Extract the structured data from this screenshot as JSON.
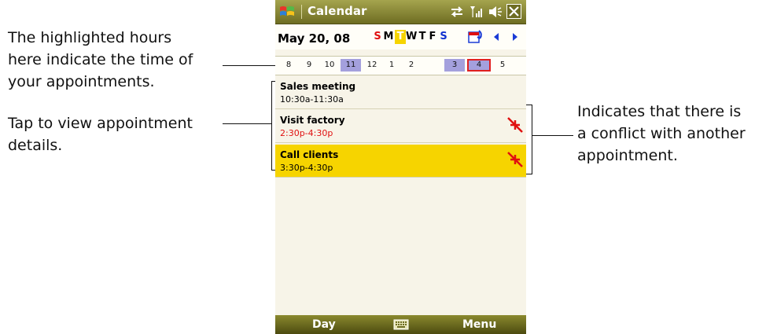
{
  "callouts": {
    "hours_note": [
      "The highlighted hours",
      "here indicate the time of",
      "your appointments."
    ],
    "tap_note": [
      "Tap to view appointment",
      "details."
    ],
    "conflict_note": [
      "Indicates that there is",
      "a conflict with another",
      "appointment."
    ]
  },
  "titlebar": {
    "title": "Calendar",
    "icons": [
      "windows-start-icon",
      "connectivity-icon",
      "signal-icon",
      "volume-icon",
      "close-icon"
    ]
  },
  "datebar": {
    "date": "May 20, 08",
    "weekdays": [
      {
        "label": "S",
        "style": "red"
      },
      {
        "label": "M",
        "style": "normal"
      },
      {
        "label": "T",
        "style": "today"
      },
      {
        "label": "W",
        "style": "normal"
      },
      {
        "label": "T",
        "style": "normal"
      },
      {
        "label": "F",
        "style": "normal"
      },
      {
        "label": "S",
        "style": "blue"
      }
    ]
  },
  "hours": [
    {
      "label": "8",
      "state": "normal"
    },
    {
      "label": "9",
      "state": "normal"
    },
    {
      "label": "10",
      "state": "normal"
    },
    {
      "label": "11",
      "state": "busy"
    },
    {
      "label": "12",
      "state": "normal"
    },
    {
      "label": "1",
      "state": "normal"
    },
    {
      "label": "2",
      "state": "normal"
    },
    {
      "label": "3",
      "state": "busy"
    },
    {
      "label": "4",
      "state": "busy-selected"
    },
    {
      "label": "5",
      "state": "normal"
    }
  ],
  "appointments": [
    {
      "title": "Sales meeting",
      "time": "10:30a-11:30a",
      "conflict": false,
      "highlighted": false
    },
    {
      "title": "Visit factory",
      "time": "2:30p-4:30p",
      "conflict": true,
      "highlighted": false
    },
    {
      "title": "Call clients",
      "time": "3:30p-4:30p",
      "conflict": true,
      "highlighted": true
    }
  ],
  "softbar": {
    "left": "Day",
    "right": "Menu"
  },
  "colors": {
    "titlebar": "#8a892e",
    "busy_hour": "#a4a0dd",
    "highlight": "#f6d400",
    "conflict": "#e01010"
  }
}
